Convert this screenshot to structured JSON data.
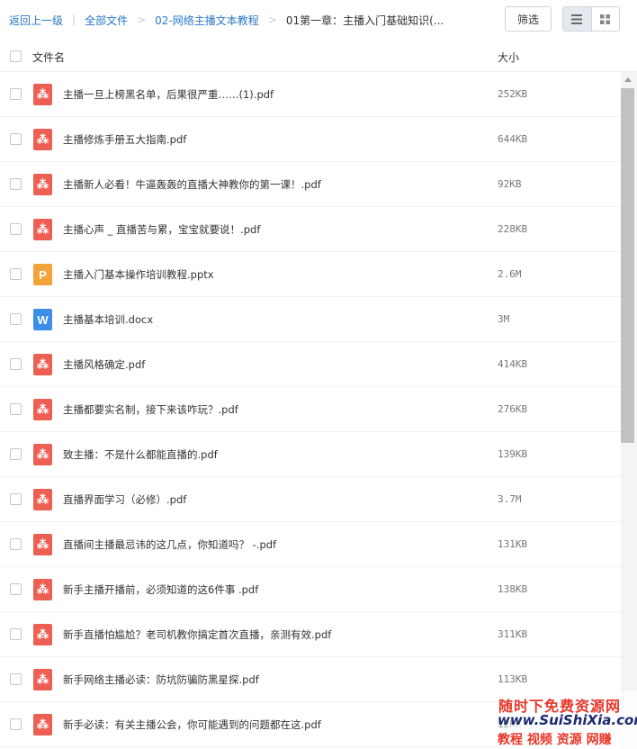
{
  "breadcrumb": {
    "back": "返回上一级",
    "items": [
      "全部文件",
      "02-网络主播文本教程"
    ],
    "current": "01第一章：主播入门基础知识(..."
  },
  "toolbar": {
    "filter_label": "筛选",
    "view_list_icon": "list-view-icon",
    "view_grid_icon": "grid-view-icon"
  },
  "table": {
    "columns": [
      "文件名",
      "大小"
    ],
    "rows": [
      {
        "type": "pdf",
        "name": "主播一旦上榜黑名单，后果很严重……(1).pdf",
        "size": "252KB"
      },
      {
        "type": "pdf",
        "name": "主播修炼手册五大指南.pdf",
        "size": "644KB"
      },
      {
        "type": "pdf",
        "name": "主播新人必看！牛逼轰轰的直播大神教你的第一课！.pdf",
        "size": "92KB"
      },
      {
        "type": "pdf",
        "name": "主播心声 _ 直播苦与累，宝宝就要说！.pdf",
        "size": "228KB"
      },
      {
        "type": "pptx",
        "name": "主播入门基本操作培训教程.pptx",
        "size": "2.6M"
      },
      {
        "type": "docx",
        "name": "主播基本培训.docx",
        "size": "3M"
      },
      {
        "type": "pdf",
        "name": "主播风格确定.pdf",
        "size": "414KB"
      },
      {
        "type": "pdf",
        "name": "主播都要实名制，接下来该咋玩？.pdf",
        "size": "276KB"
      },
      {
        "type": "pdf",
        "name": "致主播：不是什么都能直播的.pdf",
        "size": "139KB"
      },
      {
        "type": "pdf",
        "name": "直播界面学习（必修）.pdf",
        "size": "3.7M"
      },
      {
        "type": "pdf",
        "name": "直播间主播最忌讳的这几点，你知道吗？ -.pdf",
        "size": "131KB"
      },
      {
        "type": "pdf",
        "name": "新手主播开播前，必须知道的这6件事 .pdf",
        "size": "138KB"
      },
      {
        "type": "pdf",
        "name": "新手直播怕尴尬？老司机教你搞定首次直播，亲测有效.pdf",
        "size": "311KB"
      },
      {
        "type": "pdf",
        "name": "新手网络主播必读：防坑防骗防黑星探.pdf",
        "size": "113KB"
      },
      {
        "type": "pdf",
        "name": "新手必读：有关主播公会，你可能遇到的问题都在这.pdf",
        "size": "12KB"
      }
    ]
  },
  "icon_letters": {
    "pdf": "⁂",
    "pptx": "P",
    "docx": "W"
  },
  "watermark": {
    "line1": "随时下免费资源网",
    "line2": "www.SuiShiXia.com",
    "line3": "教程 视频 资源 网赚"
  },
  "colors": {
    "link": "#2a78c6",
    "pdf": "#ed5f52",
    "pptx": "#f2a33a",
    "docx": "#3b8fe8"
  }
}
